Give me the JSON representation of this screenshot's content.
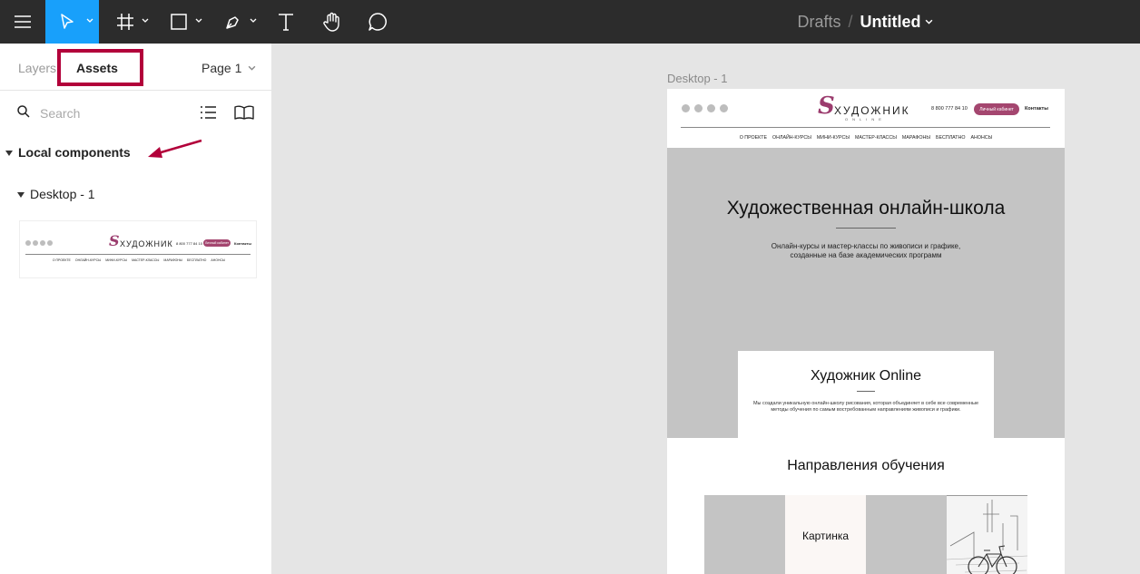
{
  "toolbar": {
    "icons": [
      "menu-icon",
      "move-tool-icon",
      "frame-tool-icon",
      "shape-tool-icon",
      "pen-tool-icon",
      "text-tool-icon",
      "hand-tool-icon",
      "comment-tool-icon"
    ],
    "accent": "#18a0fb",
    "breadcrumb_drafts": "Drafts",
    "breadcrumb_sep": "/",
    "file_name": "Untitled"
  },
  "left_panel": {
    "tab_layers": "Layers",
    "tab_assets": "Assets",
    "page_selector": "Page 1",
    "search_placeholder": "Search",
    "section_local": "Local components",
    "subsection": "Desktop - 1",
    "highlight_color": "#b2003a"
  },
  "canvas": {
    "frame_label": "Desktop - 1",
    "site": {
      "logo_word": "ХУДОЖНИК",
      "logo_sub": "ONLINE",
      "phone": "8 800 777 84 10",
      "cabinet_button": "Личный кабинет",
      "contacts": "Контакты",
      "nav": [
        "О ПРОЕКТЕ",
        "ОНЛАЙН-КУРСЫ",
        "МИНИ-КУРСЫ",
        "МАСТЕР-КЛАССЫ",
        "МАРАФОНЫ",
        "БЕСПЛАТНО",
        "АНОНСЫ"
      ],
      "hero_title": "Художественная онлайн-школа",
      "hero_sub_1": "Онлайн-курсы и мастер-классы по живописи и графике,",
      "hero_sub_2": "созданные на базе академических программ",
      "card_title": "Художник Online",
      "card_text": "Мы создали уникальную онлайн-школу рисования, которая объединяет в себе все современные методы обучения по самым востребованным направлениям живописи и графики.",
      "directions_title": "Направления обучения",
      "tile_label": "Картинка",
      "brand_color": "#a4466f"
    }
  }
}
